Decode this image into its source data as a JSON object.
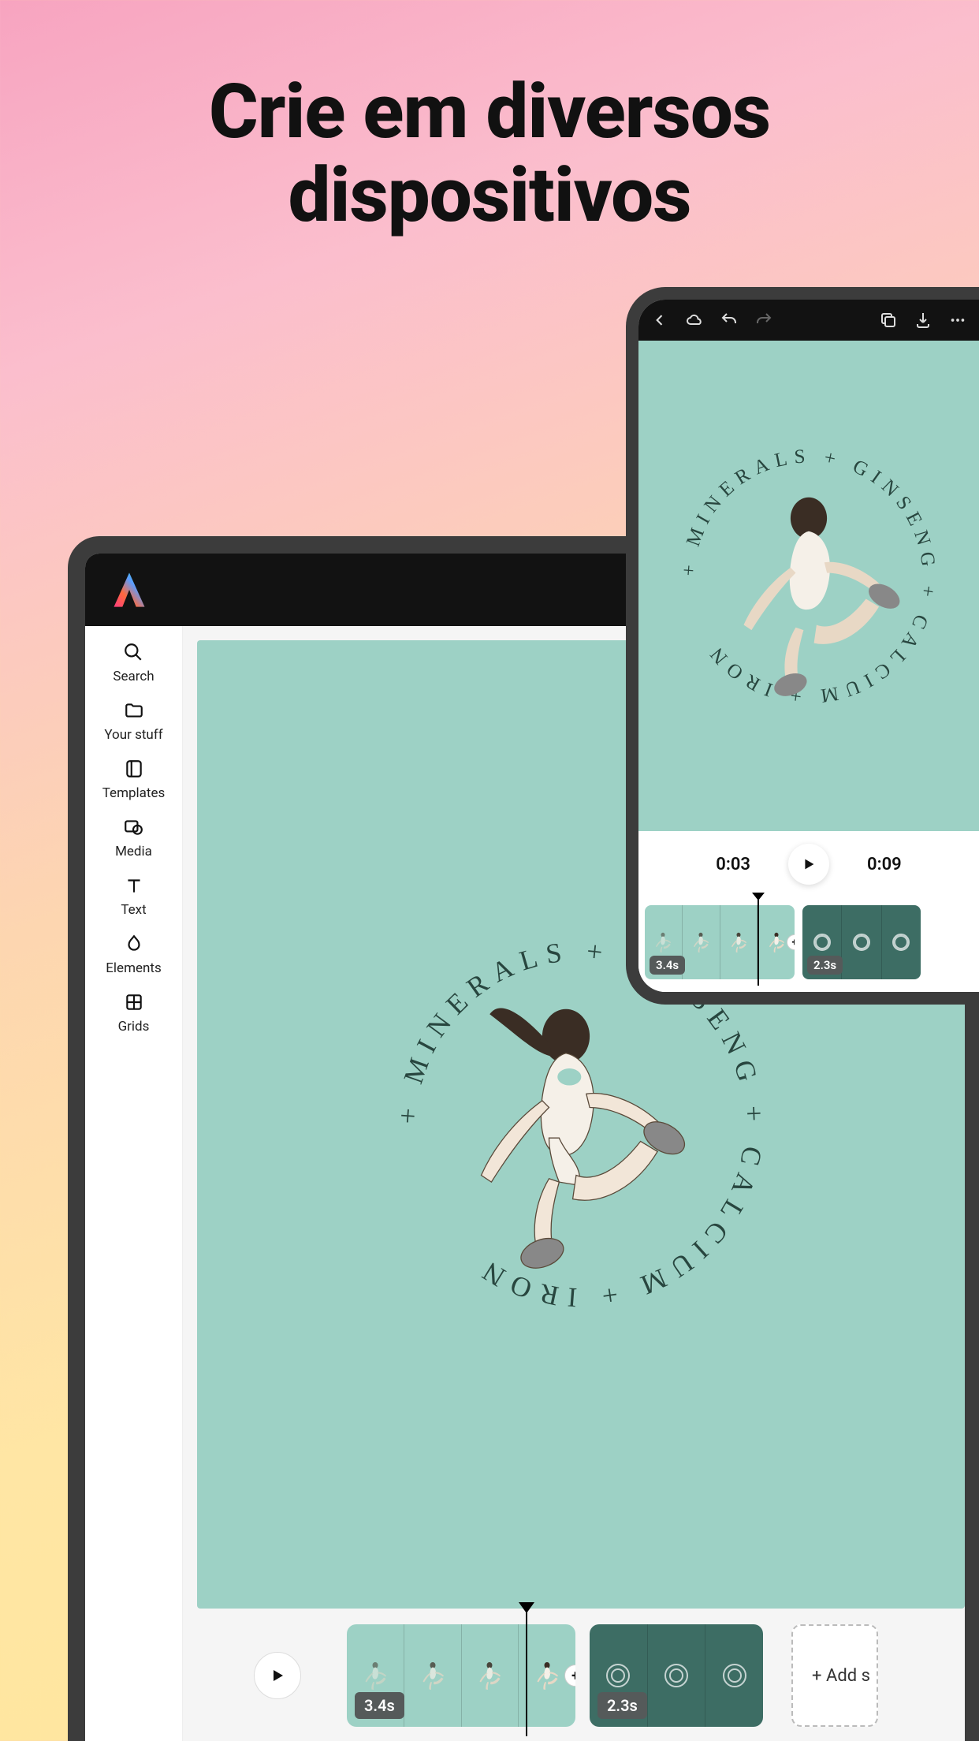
{
  "hero": {
    "line1": "Crie em diversos",
    "line2": "dispositivos"
  },
  "canvas_text": {
    "words": [
      "MINERALS",
      "GINSENG",
      "CALCIUM",
      "IRON"
    ],
    "separator": "+"
  },
  "laptop": {
    "sidebar": [
      {
        "id": "search",
        "label": "Search"
      },
      {
        "id": "yourstuff",
        "label": "Your stuff"
      },
      {
        "id": "templates",
        "label": "Templates"
      },
      {
        "id": "media",
        "label": "Media"
      },
      {
        "id": "text",
        "label": "Text"
      },
      {
        "id": "elements",
        "label": "Elements"
      },
      {
        "id": "grids",
        "label": "Grids"
      }
    ],
    "timeline": {
      "clip1_duration": "3.4s",
      "clip2_duration": "2.3s",
      "add_label": "+ Add s"
    }
  },
  "phone": {
    "toolbar_icons": [
      "back",
      "cloud",
      "undo",
      "redo",
      "duplicate",
      "download",
      "more"
    ],
    "current_time": "0:03",
    "total_time": "0:09",
    "timeline": {
      "clip1_duration": "3.4s",
      "clip2_duration": "2.3s"
    }
  }
}
